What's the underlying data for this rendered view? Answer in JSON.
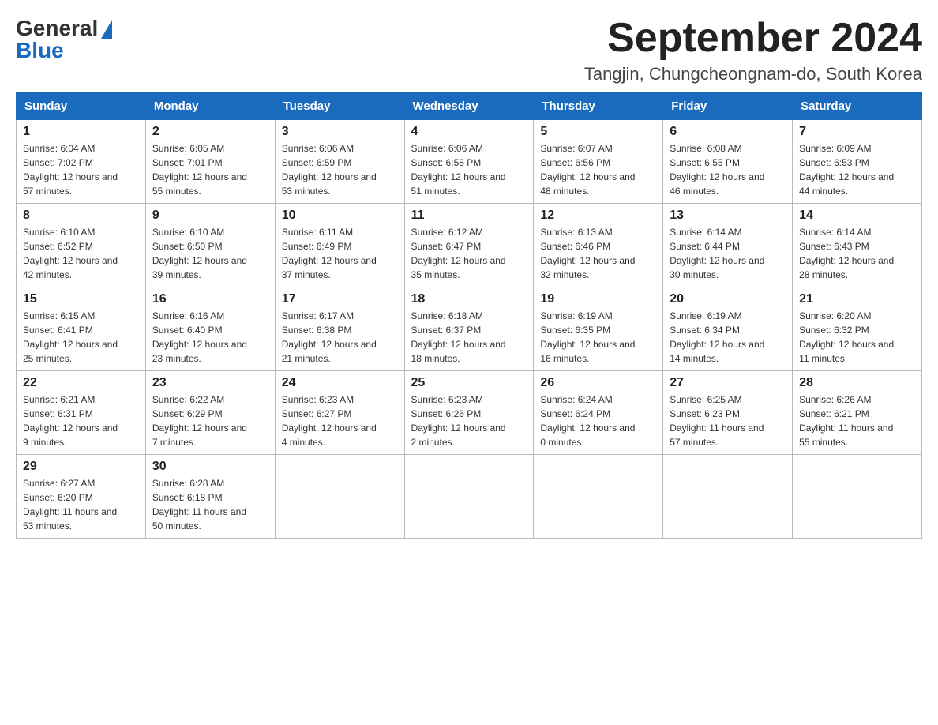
{
  "header": {
    "logo_general": "General",
    "logo_blue": "Blue",
    "main_title": "September 2024",
    "subtitle": "Tangjin, Chungcheongnam-do, South Korea"
  },
  "days_of_week": [
    "Sunday",
    "Monday",
    "Tuesday",
    "Wednesday",
    "Thursday",
    "Friday",
    "Saturday"
  ],
  "weeks": [
    [
      {
        "day": "1",
        "sunrise": "6:04 AM",
        "sunset": "7:02 PM",
        "daylight": "12 hours and 57 minutes."
      },
      {
        "day": "2",
        "sunrise": "6:05 AM",
        "sunset": "7:01 PM",
        "daylight": "12 hours and 55 minutes."
      },
      {
        "day": "3",
        "sunrise": "6:06 AM",
        "sunset": "6:59 PM",
        "daylight": "12 hours and 53 minutes."
      },
      {
        "day": "4",
        "sunrise": "6:06 AM",
        "sunset": "6:58 PM",
        "daylight": "12 hours and 51 minutes."
      },
      {
        "day": "5",
        "sunrise": "6:07 AM",
        "sunset": "6:56 PM",
        "daylight": "12 hours and 48 minutes."
      },
      {
        "day": "6",
        "sunrise": "6:08 AM",
        "sunset": "6:55 PM",
        "daylight": "12 hours and 46 minutes."
      },
      {
        "day": "7",
        "sunrise": "6:09 AM",
        "sunset": "6:53 PM",
        "daylight": "12 hours and 44 minutes."
      }
    ],
    [
      {
        "day": "8",
        "sunrise": "6:10 AM",
        "sunset": "6:52 PM",
        "daylight": "12 hours and 42 minutes."
      },
      {
        "day": "9",
        "sunrise": "6:10 AM",
        "sunset": "6:50 PM",
        "daylight": "12 hours and 39 minutes."
      },
      {
        "day": "10",
        "sunrise": "6:11 AM",
        "sunset": "6:49 PM",
        "daylight": "12 hours and 37 minutes."
      },
      {
        "day": "11",
        "sunrise": "6:12 AM",
        "sunset": "6:47 PM",
        "daylight": "12 hours and 35 minutes."
      },
      {
        "day": "12",
        "sunrise": "6:13 AM",
        "sunset": "6:46 PM",
        "daylight": "12 hours and 32 minutes."
      },
      {
        "day": "13",
        "sunrise": "6:14 AM",
        "sunset": "6:44 PM",
        "daylight": "12 hours and 30 minutes."
      },
      {
        "day": "14",
        "sunrise": "6:14 AM",
        "sunset": "6:43 PM",
        "daylight": "12 hours and 28 minutes."
      }
    ],
    [
      {
        "day": "15",
        "sunrise": "6:15 AM",
        "sunset": "6:41 PM",
        "daylight": "12 hours and 25 minutes."
      },
      {
        "day": "16",
        "sunrise": "6:16 AM",
        "sunset": "6:40 PM",
        "daylight": "12 hours and 23 minutes."
      },
      {
        "day": "17",
        "sunrise": "6:17 AM",
        "sunset": "6:38 PM",
        "daylight": "12 hours and 21 minutes."
      },
      {
        "day": "18",
        "sunrise": "6:18 AM",
        "sunset": "6:37 PM",
        "daylight": "12 hours and 18 minutes."
      },
      {
        "day": "19",
        "sunrise": "6:19 AM",
        "sunset": "6:35 PM",
        "daylight": "12 hours and 16 minutes."
      },
      {
        "day": "20",
        "sunrise": "6:19 AM",
        "sunset": "6:34 PM",
        "daylight": "12 hours and 14 minutes."
      },
      {
        "day": "21",
        "sunrise": "6:20 AM",
        "sunset": "6:32 PM",
        "daylight": "12 hours and 11 minutes."
      }
    ],
    [
      {
        "day": "22",
        "sunrise": "6:21 AM",
        "sunset": "6:31 PM",
        "daylight": "12 hours and 9 minutes."
      },
      {
        "day": "23",
        "sunrise": "6:22 AM",
        "sunset": "6:29 PM",
        "daylight": "12 hours and 7 minutes."
      },
      {
        "day": "24",
        "sunrise": "6:23 AM",
        "sunset": "6:27 PM",
        "daylight": "12 hours and 4 minutes."
      },
      {
        "day": "25",
        "sunrise": "6:23 AM",
        "sunset": "6:26 PM",
        "daylight": "12 hours and 2 minutes."
      },
      {
        "day": "26",
        "sunrise": "6:24 AM",
        "sunset": "6:24 PM",
        "daylight": "12 hours and 0 minutes."
      },
      {
        "day": "27",
        "sunrise": "6:25 AM",
        "sunset": "6:23 PM",
        "daylight": "11 hours and 57 minutes."
      },
      {
        "day": "28",
        "sunrise": "6:26 AM",
        "sunset": "6:21 PM",
        "daylight": "11 hours and 55 minutes."
      }
    ],
    [
      {
        "day": "29",
        "sunrise": "6:27 AM",
        "sunset": "6:20 PM",
        "daylight": "11 hours and 53 minutes."
      },
      {
        "day": "30",
        "sunrise": "6:28 AM",
        "sunset": "6:18 PM",
        "daylight": "11 hours and 50 minutes."
      },
      null,
      null,
      null,
      null,
      null
    ]
  ]
}
